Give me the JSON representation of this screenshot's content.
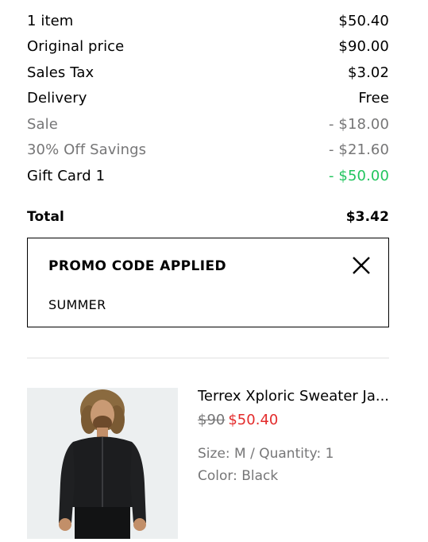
{
  "summary": {
    "rows": [
      {
        "label": "1 item",
        "value": "$50.40"
      },
      {
        "label": "Original price",
        "value": "$90.00"
      },
      {
        "label": "Sales Tax",
        "value": "$3.02"
      },
      {
        "label": "Delivery",
        "value": "Free"
      },
      {
        "label": "Sale",
        "value": "- $18.00"
      },
      {
        "label": "30% Off Savings",
        "value": "- $21.60"
      },
      {
        "label": "Gift Card 1",
        "value": "- $50.00"
      }
    ],
    "total_label": "Total",
    "total_value": "$3.42"
  },
  "promo": {
    "title": "PROMO CODE APPLIED",
    "code": "SUMMER",
    "close_icon": "close-icon"
  },
  "product": {
    "name": "Terrex Xploric Sweater Ja...",
    "old_price": "$90",
    "new_price": "$50.40",
    "size_quantity": "Size: M / Quantity: 1",
    "color": "Color: Black"
  },
  "colors": {
    "green": "#22c55e",
    "sale_red": "#e32b2b",
    "muted": "#767677",
    "image_bg": "#eceff0"
  }
}
